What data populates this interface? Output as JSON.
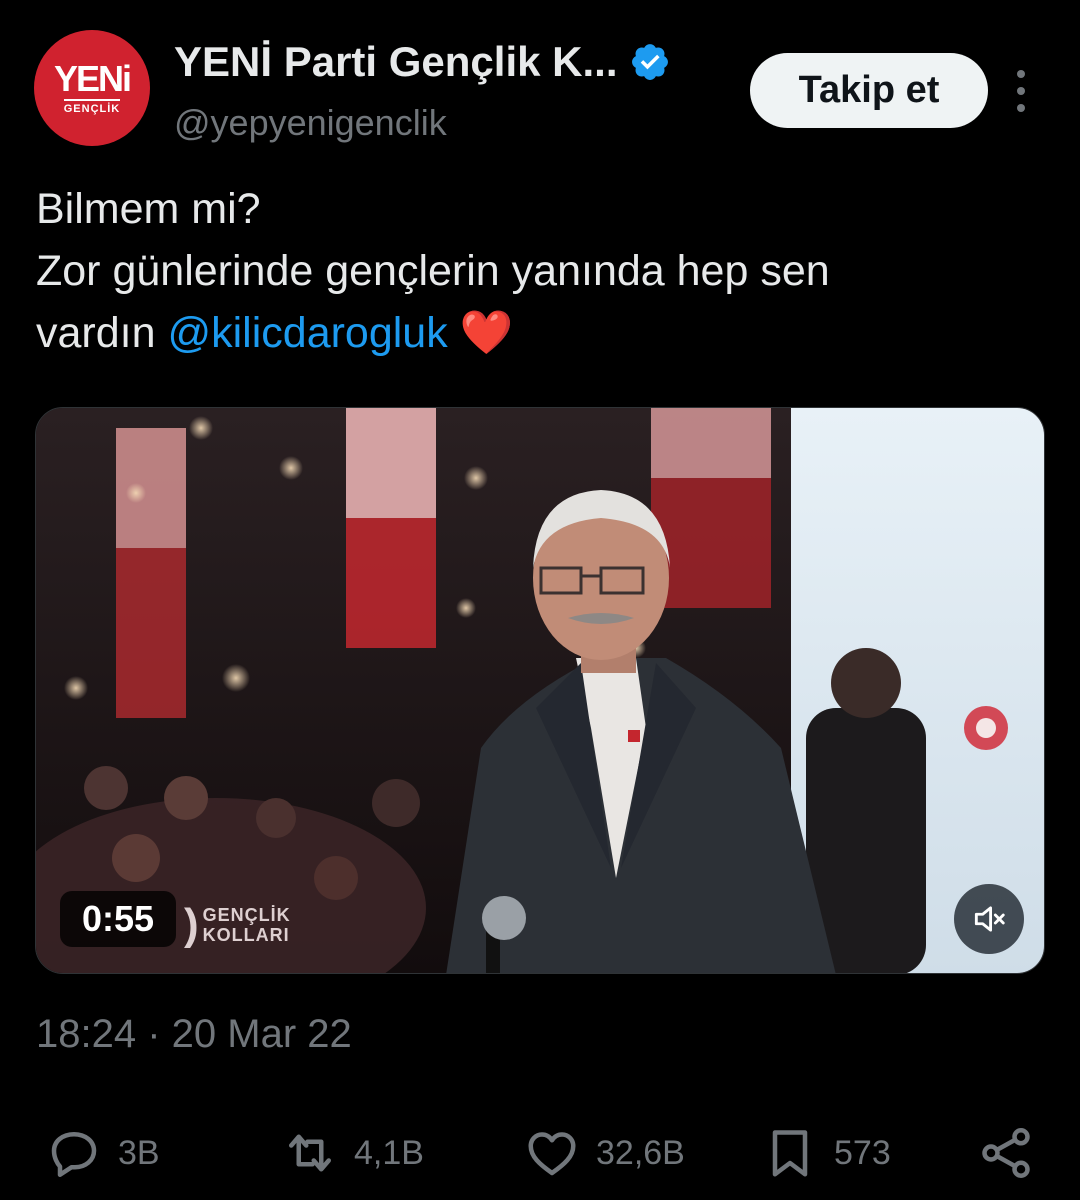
{
  "account": {
    "avatar_line1": "YENi",
    "avatar_line2": "GENÇLİK",
    "display_name": "YENİ Parti Gençlik K...",
    "handle": "@yepyenigenclik",
    "verified": true,
    "follow_label": "Takip et"
  },
  "tweet": {
    "line1": "Bilmem mi?",
    "line2": "Zor günlerinde gençlerin yanında hep sen",
    "line3_prefix": "vardın ",
    "mention": "@kilicdarogluk",
    "emoji": "❤️",
    "timestamp": "18:24 · 20 Mar 22"
  },
  "video": {
    "duration": "0:55",
    "watermark_line1": "GENÇLİK",
    "watermark_line2": "KOLLARI",
    "muted": true
  },
  "actions": {
    "replies": "3B",
    "retweets": "4,1B",
    "likes": "32,6B",
    "bookmarks": "573"
  },
  "colors": {
    "background": "#000000",
    "text": "#e7e9ea",
    "secondary": "#71767b",
    "link": "#1d9bf0",
    "verified": "#1d9bf0",
    "brand_red": "#d0222f"
  },
  "icons": {
    "verified": "verified-badge-icon",
    "more": "more-vertical-icon",
    "mute": "volume-muted-icon",
    "reply": "reply-icon",
    "retweet": "retweet-icon",
    "like": "heart-icon",
    "bookmark": "bookmark-icon",
    "share": "share-icon"
  }
}
